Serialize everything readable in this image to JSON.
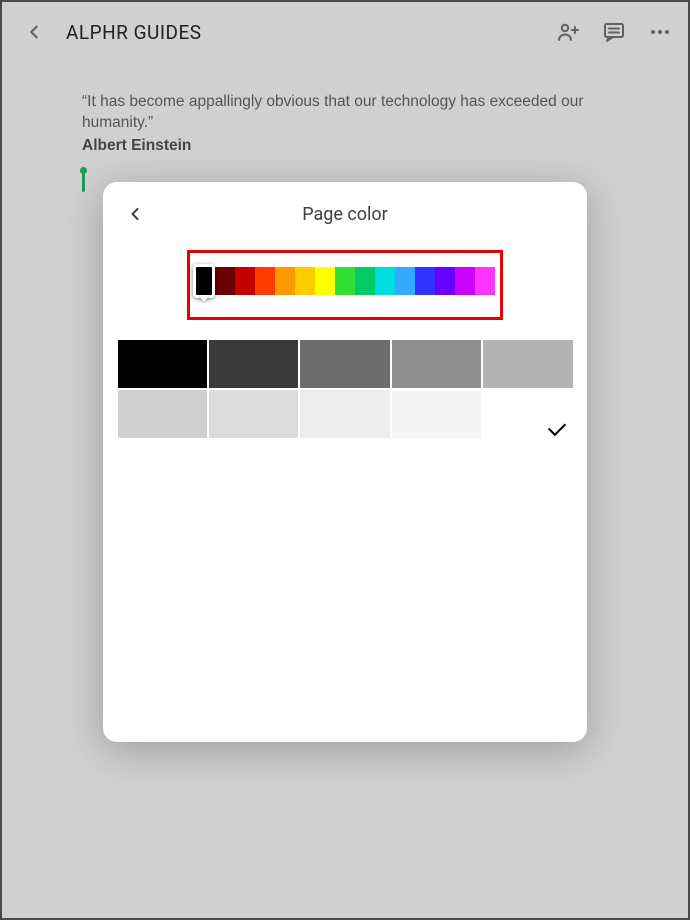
{
  "topbar": {
    "title": "ALPHR GUIDES"
  },
  "document": {
    "quote_text": "“It has become appallingly obvious that our technology has exceeded our humanity.”",
    "author": "Albert Einstein"
  },
  "modal": {
    "title": "Page color",
    "hue_colors": [
      "#000000",
      "#6b0000",
      "#c40000",
      "#ff3b00",
      "#ff9900",
      "#ffcc00",
      "#ffff00",
      "#33dd33",
      "#00cc66",
      "#00dddd",
      "#33aaff",
      "#3333ff",
      "#6600ff",
      "#cc00ff",
      "#ff33ff"
    ],
    "hue_thumb_color": "#000000",
    "swatches": [
      {
        "color": "#000000",
        "selected": false
      },
      {
        "color": "#3a3a3a",
        "selected": false
      },
      {
        "color": "#6d6d6d",
        "selected": false
      },
      {
        "color": "#8f8f8f",
        "selected": false
      },
      {
        "color": "#b3b3b3",
        "selected": false
      },
      {
        "color": "#cfcfcf",
        "selected": false
      },
      {
        "color": "#dcdcdc",
        "selected": false
      },
      {
        "color": "#ededed",
        "selected": false
      },
      {
        "color": "#f5f5f5",
        "selected": false
      },
      {
        "color": "#ffffff",
        "selected": true
      }
    ]
  },
  "annotation": {
    "highlight_color": "#e60000"
  }
}
